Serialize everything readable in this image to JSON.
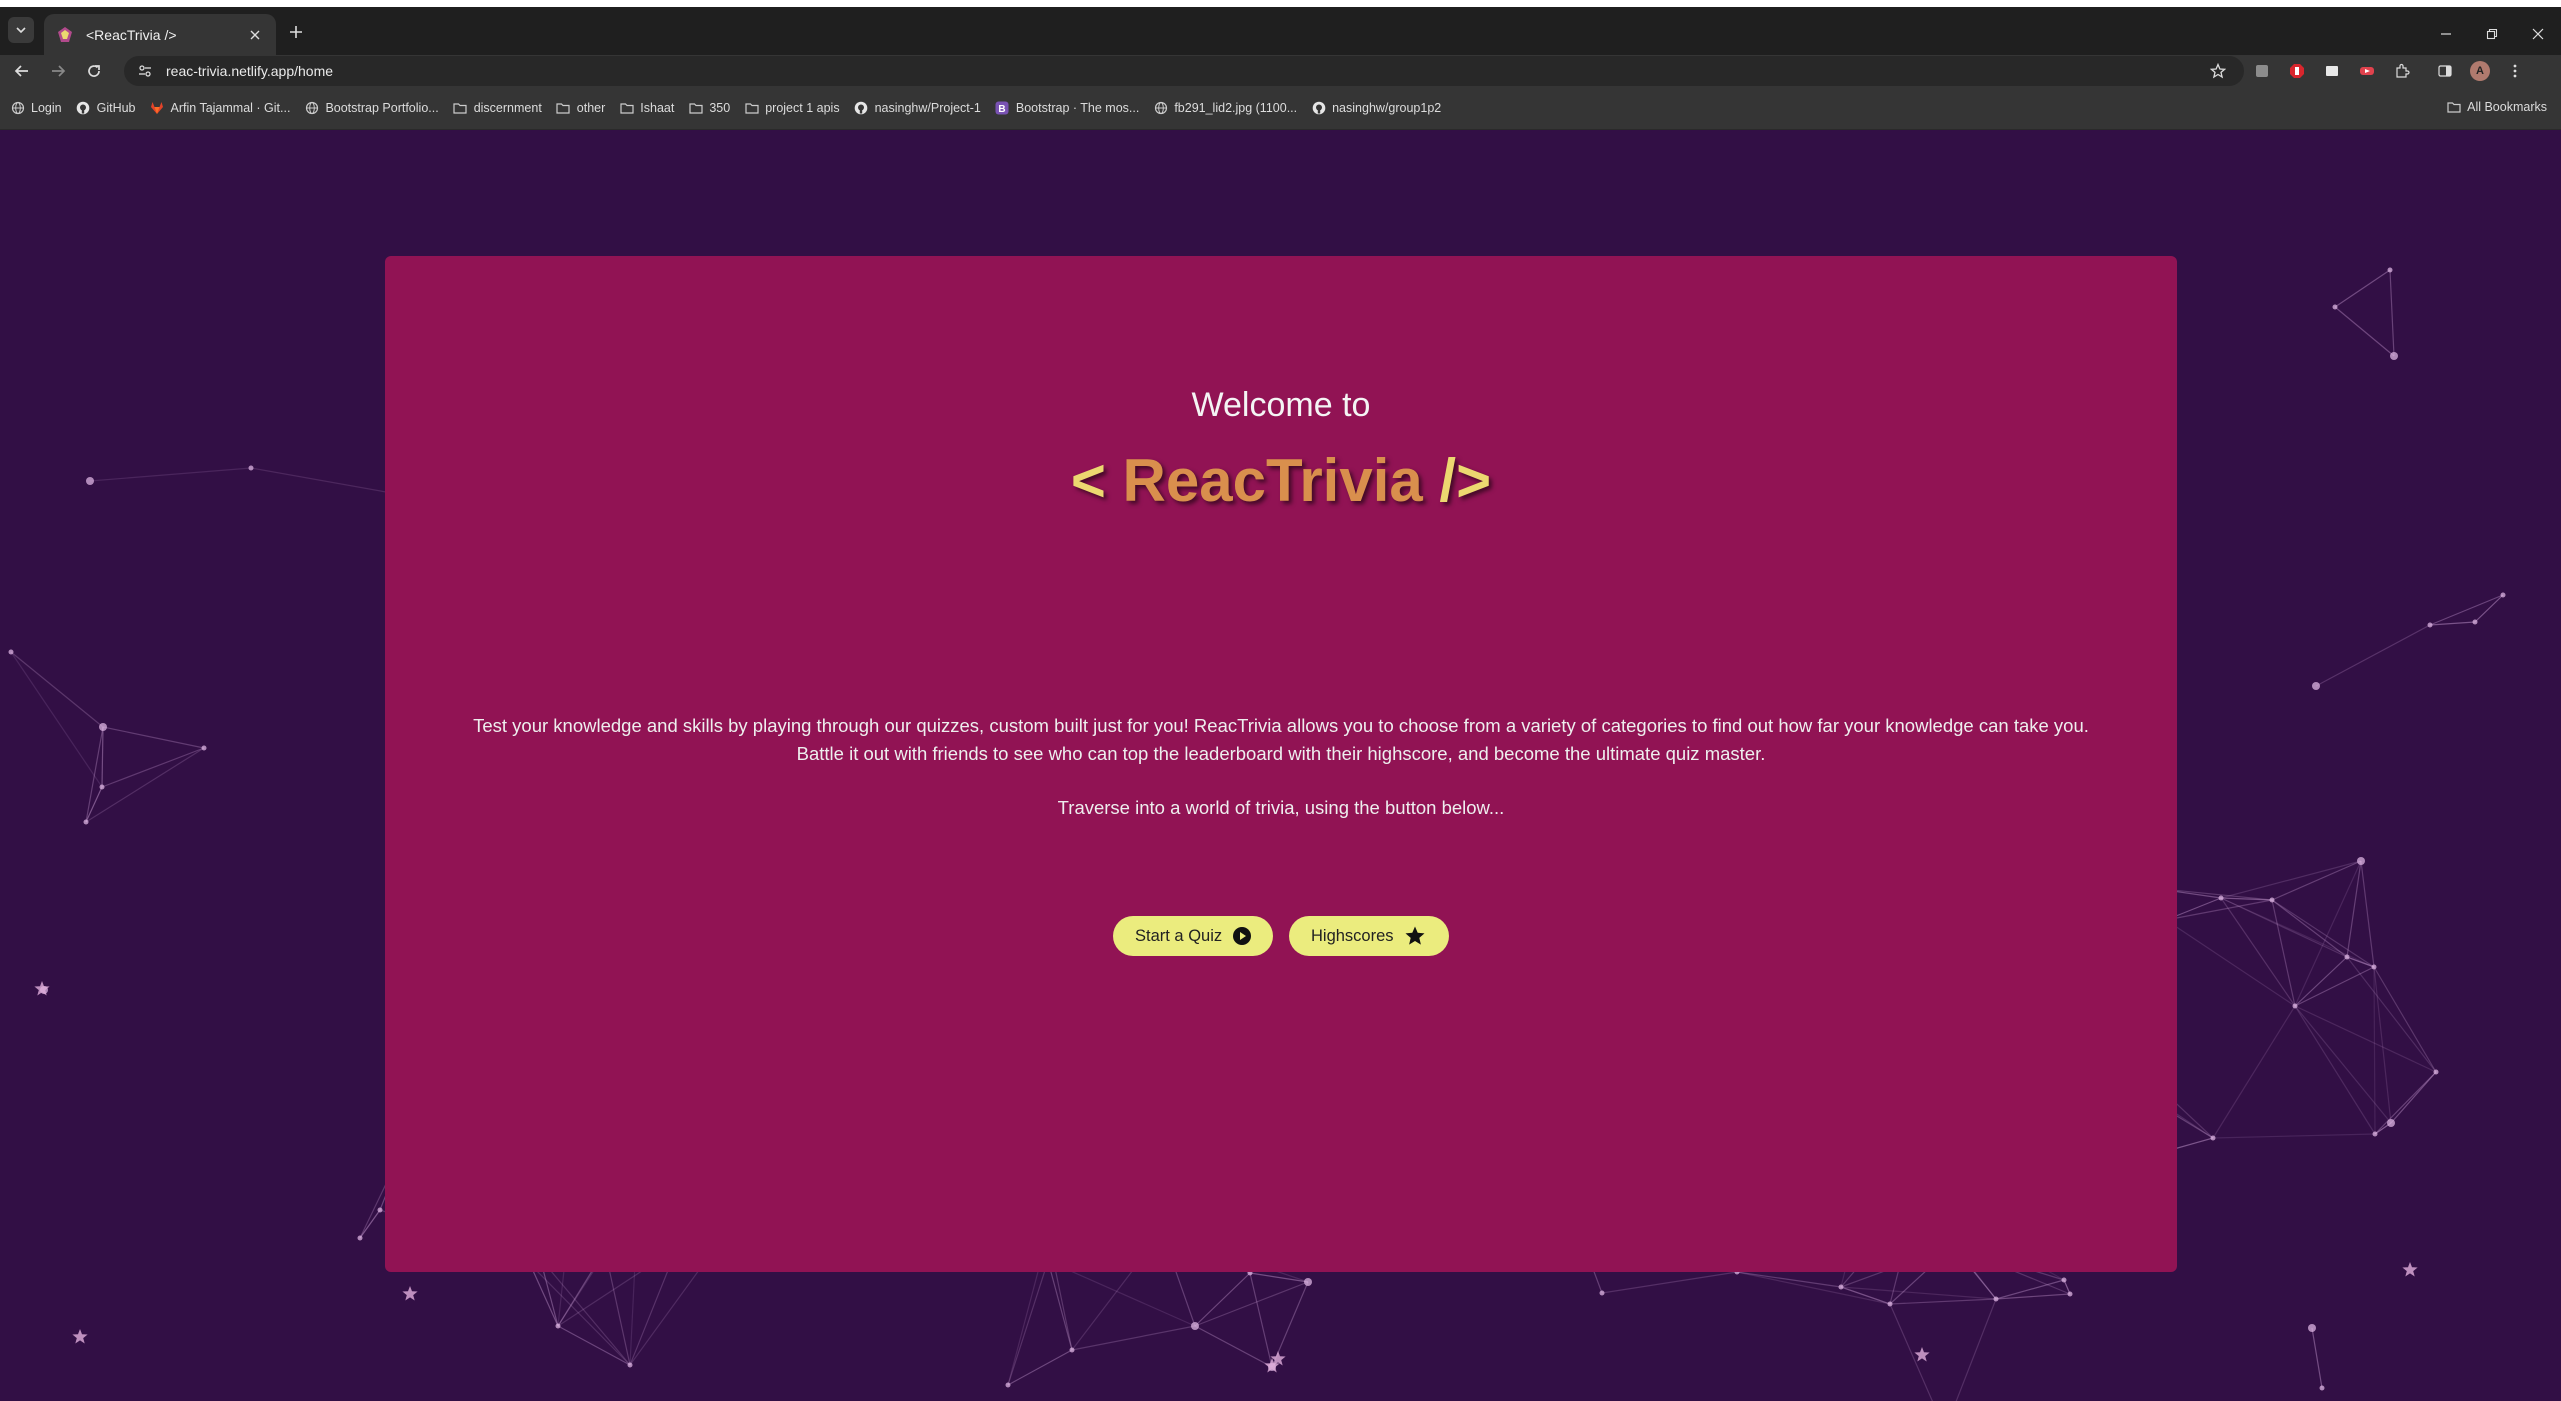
{
  "browser": {
    "tab_title": "<ReacTrivia />",
    "url": "reac-trivia.netlify.app/home",
    "profile_initial": "A",
    "bookmarks": [
      {
        "label": "Login",
        "icon": "globe-icon"
      },
      {
        "label": "GitHub",
        "icon": "github-icon"
      },
      {
        "label": "Arfin Tajammal · Git...",
        "icon": "gitlab-icon"
      },
      {
        "label": "Bootstrap Portfolio...",
        "icon": "globe-icon"
      },
      {
        "label": "discernment",
        "icon": "folder-icon"
      },
      {
        "label": "other",
        "icon": "folder-icon"
      },
      {
        "label": "Ishaat",
        "icon": "folder-icon"
      },
      {
        "label": "350",
        "icon": "folder-icon"
      },
      {
        "label": "project 1 apis",
        "icon": "folder-icon"
      },
      {
        "label": "nasinghw/Project-1",
        "icon": "github-icon"
      },
      {
        "label": "Bootstrap · The mos...",
        "icon": "bootstrap-icon"
      },
      {
        "label": "fb291_lid2.jpg (1100...",
        "icon": "globe-icon"
      },
      {
        "label": "nasinghw/group1p2",
        "icon": "github-icon"
      }
    ],
    "all_bookmarks_label": "All Bookmarks"
  },
  "page": {
    "welcome": "Welcome to",
    "logo_open": "< ",
    "logo_name": "ReacTrivia",
    "logo_close": " />",
    "intro": "Test your knowledge and skills by playing through our quizzes, custom built just for you! ReacTrivia allows you to choose from a variety of categories to find out how far your knowledge can take you. Battle it out with friends to see who can top the leaderboard with their highscore, and become the ultimate quiz master.",
    "traverse": "Traverse into a world of trivia, using the button below...",
    "start_quiz_label": "Start a Quiz",
    "highscores_label": "Highscores"
  },
  "colors": {
    "background": "#320f45",
    "card": "#911354",
    "button": "#ebec7e",
    "logo_bracket": "#ecd870",
    "logo_name": "#d98f4d"
  }
}
